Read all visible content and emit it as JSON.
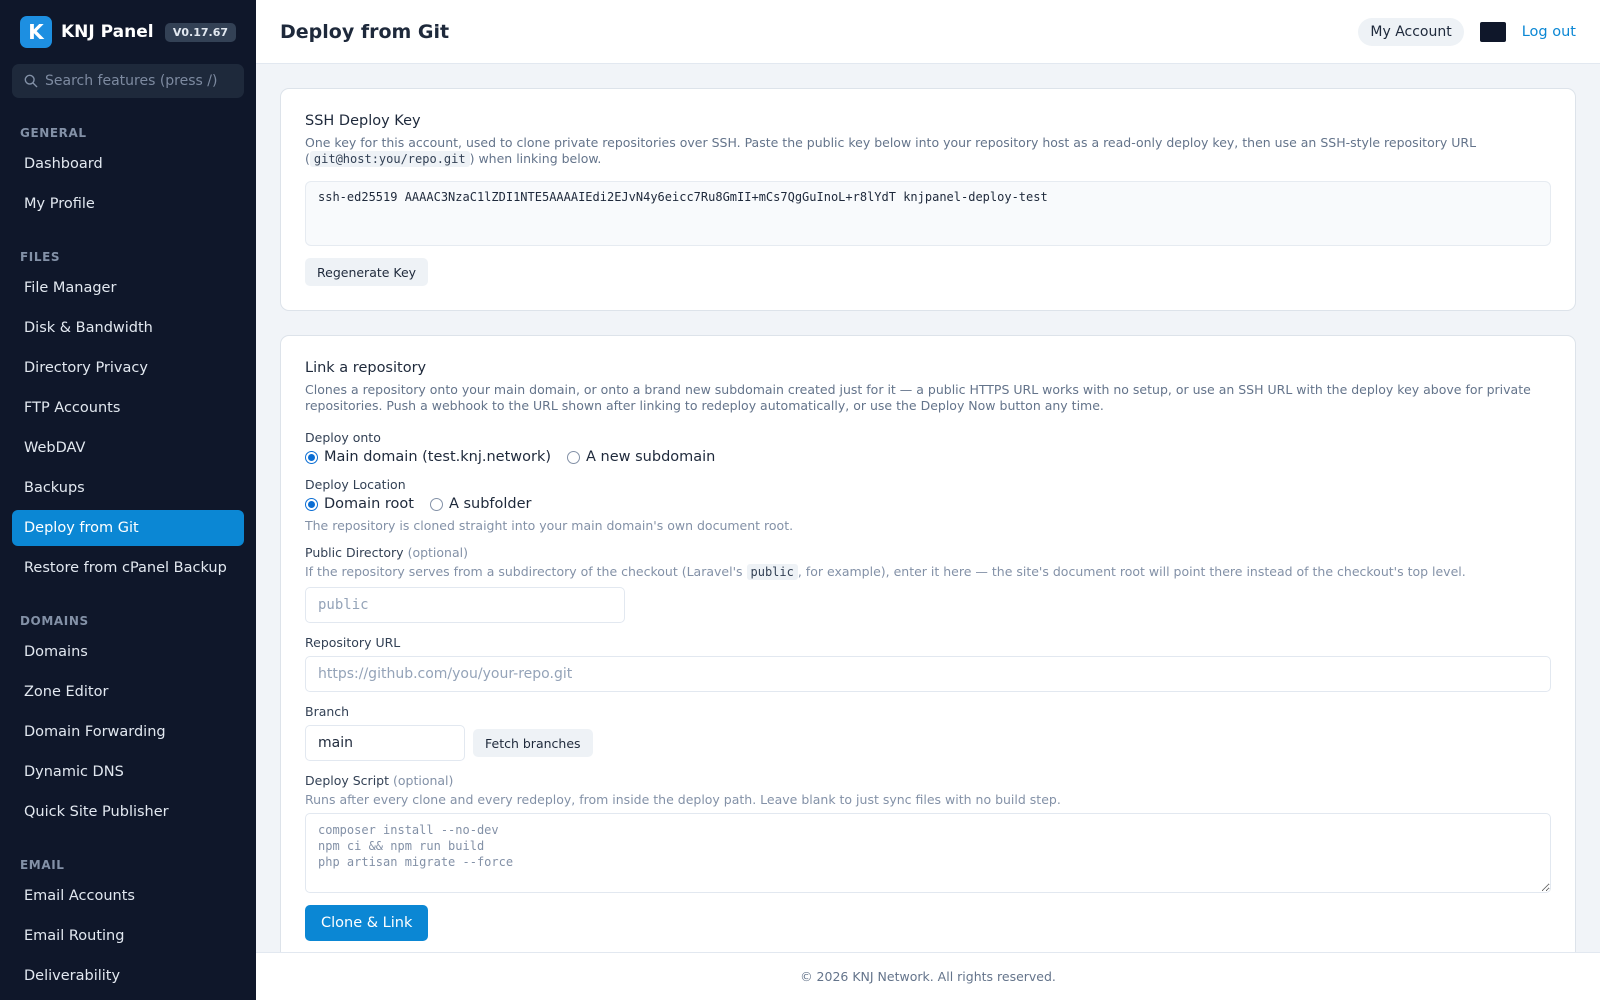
{
  "sidebar": {
    "brand": "KNJ Panel",
    "logo_letter": "K",
    "version": "V0.17.67",
    "search_placeholder": "Search features (press /)",
    "sections": {
      "general": "GENERAL",
      "files": "FILES",
      "domains": "DOMAINS",
      "email": "EMAIL"
    },
    "items": {
      "dashboard": "Dashboard",
      "my_profile": "My Profile",
      "file_manager": "File Manager",
      "disk_bandwidth": "Disk & Bandwidth",
      "directory_privacy": "Directory Privacy",
      "ftp_accounts": "FTP Accounts",
      "webdav": "WebDAV",
      "backups": "Backups",
      "deploy_git": "Deploy from Git",
      "restore_cpanel": "Restore from cPanel Backup",
      "domains": "Domains",
      "zone_editor": "Zone Editor",
      "domain_forwarding": "Domain Forwarding",
      "dynamic_dns": "Dynamic DNS",
      "quick_site": "Quick Site Publisher",
      "email_accounts": "Email Accounts",
      "email_routing": "Email Routing",
      "deliverability": "Deliverability"
    }
  },
  "header": {
    "title": "Deploy from Git",
    "my_account": "My Account",
    "logout": "Log out"
  },
  "ssh_card": {
    "title": "SSH Deploy Key",
    "desc_before": "One key for this account, used to clone private repositories over SSH. Paste the public key below into your repository host as a read-only deploy key, then use an SSH-style repository URL (",
    "desc_code": "git@host:you/repo.git",
    "desc_after": ") when linking below.",
    "key": "ssh-ed25519 AAAAC3NzaC1lZDI1NTE5AAAAIEdi2EJvN4y6eicc7Ru8GmII+mCs7QgGuInoL+r8lYdT knjpanel-deploy-test",
    "regenerate": "Regenerate Key"
  },
  "link_card": {
    "title": "Link a repository",
    "desc": "Clones a repository onto your main domain, or onto a brand new subdomain created just for it — a public HTTPS URL works with no setup, or use an SSH URL with the deploy key above for private repositories. Push a webhook to the URL shown after linking to redeploy automatically, or use the Deploy Now button any time.",
    "deploy_onto_label": "Deploy onto",
    "deploy_onto_main": "Main domain (test.knj.network)",
    "deploy_onto_sub": "A new subdomain",
    "location_label": "Deploy Location",
    "location_root": "Domain root",
    "location_sub": "A subfolder",
    "location_hint": "The repository is cloned straight into your main domain's own document root.",
    "public_dir_label": "Public Directory",
    "optional": "(optional)",
    "public_dir_hint_before": "If the repository serves from a subdirectory of the checkout (Laravel's ",
    "public_dir_hint_code": "public",
    "public_dir_hint_after": ", for example), enter it here — the site's document root will point there instead of the checkout's top level.",
    "public_dir_placeholder": "public",
    "repo_url_label": "Repository URL",
    "repo_url_placeholder": "https://github.com/you/your-repo.git",
    "branch_label": "Branch",
    "branch_value": "main",
    "fetch_branches": "Fetch branches",
    "script_label": "Deploy Script",
    "script_hint": "Runs after every clone and every redeploy, from inside the deploy path. Leave blank to just sync files with no build step.",
    "script_placeholder": "composer install --no-dev\nnpm ci && npm run build\nphp artisan migrate --force",
    "clone_link": "Clone & Link"
  },
  "footer": {
    "text": "© 2026 KNJ Network. All rights reserved."
  }
}
